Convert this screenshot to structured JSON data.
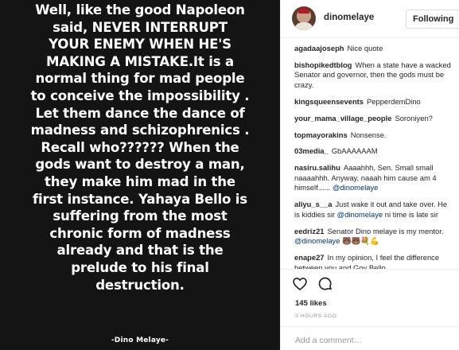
{
  "post": {
    "quote": "Well, like the good Napoleon\nsaid, NEVER INTERRUPT\nYOUR ENEMY WHEN HE'S\nMAKING A MISTAKE.It is a\nnormal thing for mad people\nto conceive the impossibility .\nLet them dance the dance of\nmadness and schizophrenics .\nRecall who?????? When the\ngods want to destroy a man,\nthey make him mad in the\nfirst instance. Yahaya Bello is\nsuffering from the most\nchronic form of madness\nalready and that is the\nprelude to his final\ndestruction.",
    "signature": "-Dino Melaye-"
  },
  "header": {
    "username": "dinomelaye",
    "follow_label": "Following"
  },
  "comments": [
    {
      "user": "agadaajoseph",
      "text": "Nice quote"
    },
    {
      "user": "bishopikedtblog",
      "text": "When a state have a wacked Senator and governor, then the gods must be crazy."
    },
    {
      "user": "kingsqueensevents",
      "text": "PepperdemDino"
    },
    {
      "user": "your_mama_village_people",
      "text": "Soroniyen?"
    },
    {
      "user": "topmayorakins",
      "text": "Nonsense."
    },
    {
      "user": "03media_",
      "text": "GbAAAAAAM"
    },
    {
      "user": "nasiru.salihu",
      "text": "Aaaahhh, Sen. Small small naaaahhh. Anyway, naaah him cause am 4 himself......",
      "mention": "@dinomelaye"
    },
    {
      "user": "aliyu_s__a",
      "text": "Just wake it out and take over. He is kiddies sir",
      "mention": "@dinomelaye",
      "tail": "ni time is late sir"
    },
    {
      "user": "eedriz21",
      "text": "Senator Dino melaye is my mentor.",
      "mention": "@dinomelaye",
      "tail": "🐻🐻💐💪"
    },
    {
      "user": "enape27",
      "text": "In my opinion, I feel the difference between you and Gov Bello"
    }
  ],
  "actions": {
    "like_icon": "heart-icon",
    "comment_icon": "speech-bubble-icon"
  },
  "likes": "145 likes",
  "time_ago": "3 HOURS AGO",
  "add_comment": {
    "placeholder": "Add a comment…"
  }
}
